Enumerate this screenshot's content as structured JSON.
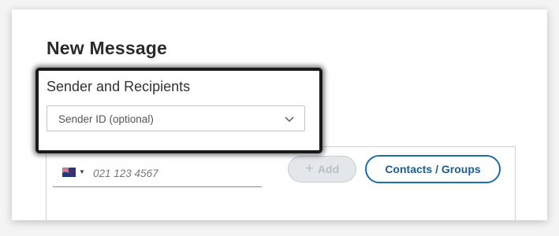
{
  "page": {
    "title": "New Message"
  },
  "sender": {
    "section_label": "Sender and Recipients",
    "sender_id_value": "Sender ID (optional)"
  },
  "recipients": {
    "country_flag": "NZ",
    "phone_placeholder": "021 123 4567",
    "add_label": "Add",
    "contacts_label": "Contacts / Groups"
  },
  "icons": {
    "select_arrow": "chevron-down-icon",
    "country": "nz-flag-icon",
    "add": "plus-icon"
  },
  "colors": {
    "accent": "#1c6fa6",
    "disabled_button_bg": "#e3e7ea",
    "highlight_border": "#1a1a1a"
  }
}
